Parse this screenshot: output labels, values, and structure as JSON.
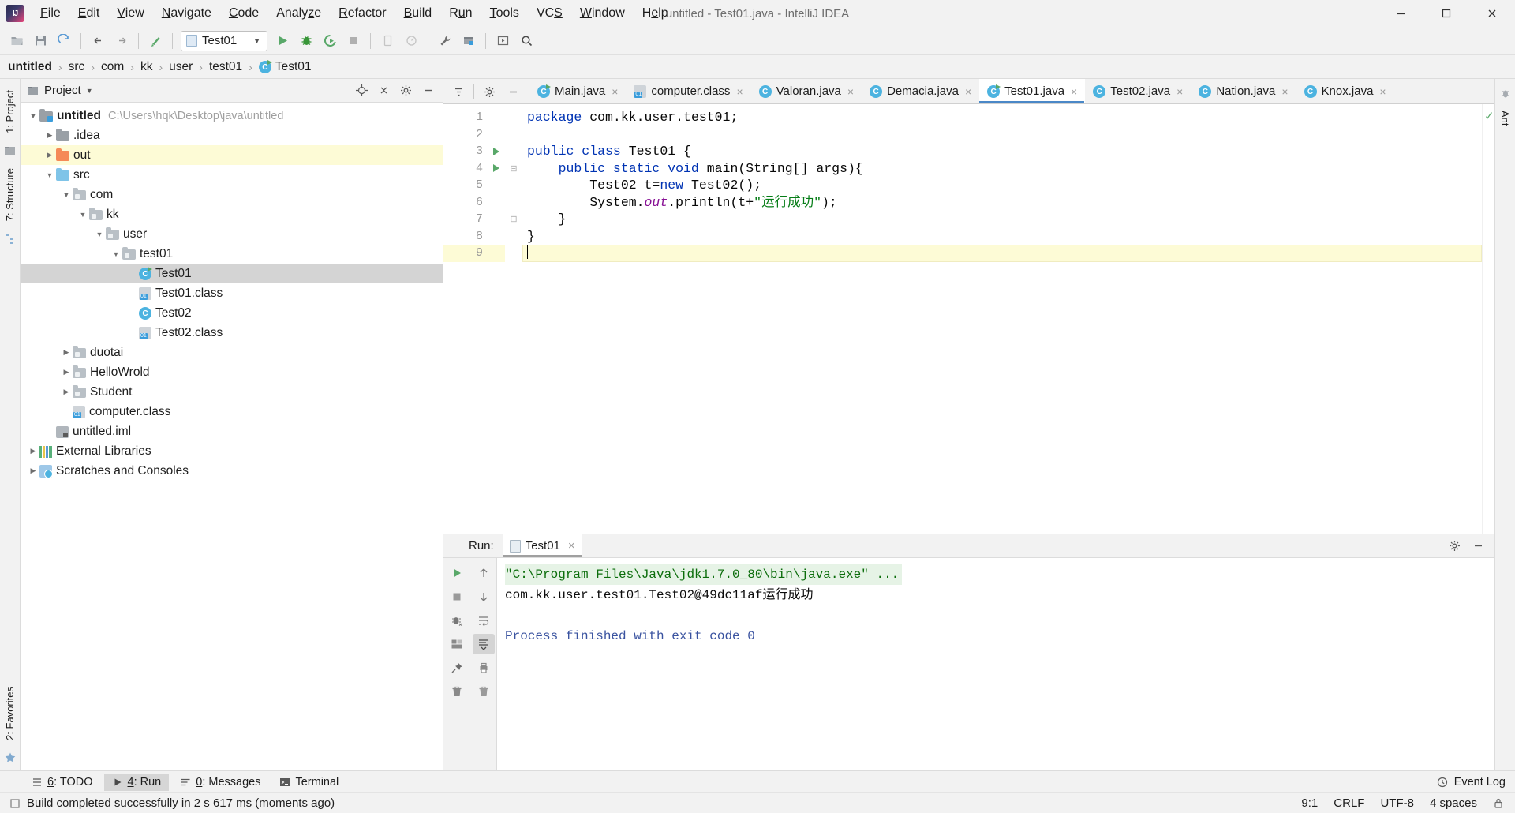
{
  "window": {
    "title": "untitled - Test01.java - IntelliJ IDEA",
    "logo_icon": "intellij-idea-logo-icon",
    "minimize_icon": "minimize-icon",
    "maximize_icon": "maximize-icon",
    "close_icon": "close-icon"
  },
  "menubar": {
    "items": [
      {
        "label": "File",
        "mnemonic": "F"
      },
      {
        "label": "Edit",
        "mnemonic": "E"
      },
      {
        "label": "View",
        "mnemonic": "V"
      },
      {
        "label": "Navigate",
        "mnemonic": "N"
      },
      {
        "label": "Code",
        "mnemonic": "C"
      },
      {
        "label": "Analyze",
        "mnemonic": "z"
      },
      {
        "label": "Refactor",
        "mnemonic": "R"
      },
      {
        "label": "Build",
        "mnemonic": "B"
      },
      {
        "label": "Run",
        "mnemonic": "u"
      },
      {
        "label": "Tools",
        "mnemonic": "T"
      },
      {
        "label": "VCS",
        "mnemonic": "S"
      },
      {
        "label": "Window",
        "mnemonic": "W"
      },
      {
        "label": "Help",
        "mnemonic": "H"
      }
    ]
  },
  "toolbar": {
    "buttons": [
      {
        "name": "open-project-icon",
        "glyph": "folder"
      },
      {
        "name": "save-all-icon",
        "glyph": "save"
      },
      {
        "name": "sync-icon",
        "glyph": "sync"
      },
      {
        "name": "back-icon",
        "glyph": "arrow-left"
      },
      {
        "name": "forward-icon",
        "glyph": "arrow-right"
      },
      {
        "name": "last-edit-location-icon",
        "glyph": "pointer"
      }
    ],
    "run_config": {
      "label": "Test01",
      "icon": "run-configuration-icon",
      "dropdown_icon": "chevron-down-icon"
    },
    "right_buttons": [
      {
        "name": "run-icon",
        "glyph": "play"
      },
      {
        "name": "debug-icon",
        "glyph": "bug"
      },
      {
        "name": "run-with-coverage-icon",
        "glyph": "coverage"
      },
      {
        "name": "stop-icon",
        "glyph": "stop"
      },
      {
        "name": "attach-debugger-icon",
        "glyph": "attach"
      },
      {
        "name": "profiler-icon",
        "glyph": "profiler"
      },
      {
        "name": "settings-wrench-icon",
        "glyph": "wrench"
      },
      {
        "name": "project-structure-icon",
        "glyph": "structure"
      },
      {
        "name": "run-anything-icon",
        "glyph": "runany"
      },
      {
        "name": "search-everywhere-icon",
        "glyph": "search"
      }
    ]
  },
  "breadcrumb": {
    "items": [
      {
        "label": "untitled",
        "bold": true,
        "icon": ""
      },
      {
        "label": "src",
        "bold": false,
        "icon": ""
      },
      {
        "label": "com",
        "bold": false,
        "icon": ""
      },
      {
        "label": "kk",
        "bold": false,
        "icon": ""
      },
      {
        "label": "user",
        "bold": false,
        "icon": ""
      },
      {
        "label": "test01",
        "bold": false,
        "icon": ""
      },
      {
        "label": "Test01",
        "bold": false,
        "icon": "java-class-icon"
      }
    ],
    "separator": "›"
  },
  "left_strip": {
    "tabs": [
      {
        "label": "1: Project",
        "name": "tool-window-project"
      },
      {
        "label": "7: Structure",
        "name": "tool-window-structure"
      },
      {
        "label": "2: Favorites",
        "name": "tool-window-favorites"
      }
    ]
  },
  "right_strip": {
    "tabs": [
      {
        "label": "Ant",
        "name": "tool-window-ant"
      }
    ]
  },
  "project_panel": {
    "title": "Project",
    "dropdown_icon": "chevron-down-icon",
    "actions": [
      {
        "name": "locate-icon",
        "glyph": "target"
      },
      {
        "name": "collapse-all-icon",
        "glyph": "collapse"
      },
      {
        "name": "settings-gear-icon",
        "glyph": "gear"
      },
      {
        "name": "hide-panel-icon",
        "glyph": "minus"
      }
    ],
    "tree": [
      {
        "label": "untitled",
        "sub": "C:\\Users\\hqk\\Desktop\\java\\untitled",
        "indent": 0,
        "arrow": "down",
        "icon": "module-icon",
        "bold": true,
        "state": ""
      },
      {
        "label": ".idea",
        "sub": "",
        "indent": 1,
        "arrow": "right",
        "icon": "folder-icon",
        "bold": false,
        "state": ""
      },
      {
        "label": "out",
        "sub": "",
        "indent": 1,
        "arrow": "right",
        "icon": "folder-orange-icon",
        "bold": false,
        "state": "highlight"
      },
      {
        "label": "src",
        "sub": "",
        "indent": 1,
        "arrow": "down",
        "icon": "folder-blue-icon",
        "bold": false,
        "state": ""
      },
      {
        "label": "com",
        "sub": "",
        "indent": 2,
        "arrow": "down",
        "icon": "package-icon",
        "bold": false,
        "state": ""
      },
      {
        "label": "kk",
        "sub": "",
        "indent": 3,
        "arrow": "down",
        "icon": "package-icon",
        "bold": false,
        "state": ""
      },
      {
        "label": "user",
        "sub": "",
        "indent": 4,
        "arrow": "down",
        "icon": "package-icon",
        "bold": false,
        "state": ""
      },
      {
        "label": "test01",
        "sub": "",
        "indent": 5,
        "arrow": "down",
        "icon": "package-icon",
        "bold": false,
        "state": ""
      },
      {
        "label": "Test01",
        "sub": "",
        "indent": 6,
        "arrow": "none",
        "icon": "java-class-runnable-icon",
        "bold": false,
        "state": "selected"
      },
      {
        "label": "Test01.class",
        "sub": "",
        "indent": 6,
        "arrow": "none",
        "icon": "class-file-icon",
        "bold": false,
        "state": ""
      },
      {
        "label": "Test02",
        "sub": "",
        "indent": 6,
        "arrow": "none",
        "icon": "java-class-icon",
        "bold": false,
        "state": ""
      },
      {
        "label": "Test02.class",
        "sub": "",
        "indent": 6,
        "arrow": "none",
        "icon": "class-file-icon",
        "bold": false,
        "state": ""
      },
      {
        "label": "duotai",
        "sub": "",
        "indent": 2,
        "arrow": "right",
        "icon": "package-icon",
        "bold": false,
        "state": ""
      },
      {
        "label": "HelloWrold",
        "sub": "",
        "indent": 2,
        "arrow": "right",
        "icon": "package-icon",
        "bold": false,
        "state": ""
      },
      {
        "label": "Student",
        "sub": "",
        "indent": 2,
        "arrow": "right",
        "icon": "package-icon",
        "bold": false,
        "state": ""
      },
      {
        "label": "computer.class",
        "sub": "",
        "indent": 2,
        "arrow": "none",
        "icon": "class-file-icon",
        "bold": false,
        "state": ""
      },
      {
        "label": "untitled.iml",
        "sub": "",
        "indent": 1,
        "arrow": "none",
        "icon": "iml-file-icon",
        "bold": false,
        "state": ""
      },
      {
        "label": "External Libraries",
        "sub": "",
        "indent": 0,
        "arrow": "right",
        "icon": "library-icon",
        "bold": false,
        "state": ""
      },
      {
        "label": "Scratches and Consoles",
        "sub": "",
        "indent": 0,
        "arrow": "right",
        "icon": "scratches-icon",
        "bold": false,
        "state": ""
      }
    ]
  },
  "editor": {
    "tab_actions": [
      {
        "name": "select-opened-file-icon",
        "glyph": "selectfile"
      },
      {
        "name": "editor-settings-gear-icon",
        "glyph": "gear"
      },
      {
        "name": "hide-editor-icon",
        "glyph": "minus"
      }
    ],
    "tabs": [
      {
        "label": "Main.java",
        "icon": "java-class-runnable-icon",
        "active": false
      },
      {
        "label": "computer.class",
        "icon": "class-file-icon",
        "active": false
      },
      {
        "label": "Valoran.java",
        "icon": "java-class-icon",
        "active": false
      },
      {
        "label": "Demacia.java",
        "icon": "java-class-icon",
        "active": false
      },
      {
        "label": "Test01.java",
        "icon": "java-class-runnable-icon",
        "active": true
      },
      {
        "label": "Test02.java",
        "icon": "java-class-icon",
        "active": false
      },
      {
        "label": "Nation.java",
        "icon": "java-class-icon",
        "active": false
      },
      {
        "label": "Knox.java",
        "icon": "java-class-icon",
        "active": false
      }
    ],
    "close_glyph": "×",
    "inspection_ok_icon": "checkmark-icon",
    "lines": [
      {
        "num": "1",
        "runmark": false,
        "fold": "",
        "highlight": false,
        "tokens": [
          {
            "t": "package ",
            "c": "kw"
          },
          {
            "t": "com.kk.user.test01;",
            "c": "plain"
          }
        ]
      },
      {
        "num": "2",
        "runmark": false,
        "fold": "",
        "highlight": false,
        "tokens": []
      },
      {
        "num": "3",
        "runmark": true,
        "fold": "",
        "highlight": false,
        "tokens": [
          {
            "t": "public class ",
            "c": "kw"
          },
          {
            "t": "Test01 {",
            "c": "plain"
          }
        ]
      },
      {
        "num": "4",
        "runmark": true,
        "fold": "⊟",
        "highlight": false,
        "tokens": [
          {
            "t": "    ",
            "c": "plain"
          },
          {
            "t": "public static void ",
            "c": "kw"
          },
          {
            "t": "main(String[] args){",
            "c": "plain"
          }
        ]
      },
      {
        "num": "5",
        "runmark": false,
        "fold": "",
        "highlight": false,
        "tokens": [
          {
            "t": "        Test02 t=",
            "c": "plain"
          },
          {
            "t": "new ",
            "c": "kw"
          },
          {
            "t": "Test02();",
            "c": "plain"
          }
        ]
      },
      {
        "num": "6",
        "runmark": false,
        "fold": "",
        "highlight": false,
        "tokens": [
          {
            "t": "        System.",
            "c": "plain"
          },
          {
            "t": "out",
            "c": "fld"
          },
          {
            "t": ".println(t+",
            "c": "plain"
          },
          {
            "t": "\"运行成功\"",
            "c": "str"
          },
          {
            "t": ");",
            "c": "plain"
          }
        ]
      },
      {
        "num": "7",
        "runmark": false,
        "fold": "⊟",
        "highlight": false,
        "tokens": [
          {
            "t": "    }",
            "c": "plain"
          }
        ]
      },
      {
        "num": "8",
        "runmark": false,
        "fold": "",
        "highlight": false,
        "tokens": [
          {
            "t": "}",
            "c": "plain"
          }
        ]
      },
      {
        "num": "9",
        "runmark": false,
        "fold": "",
        "highlight": true,
        "tokens": []
      }
    ]
  },
  "run_panel": {
    "label": "Run:",
    "tab_label": "Test01",
    "tab_icon": "console-icon",
    "tab_close": "×",
    "header_actions": [
      {
        "name": "run-panel-settings-icon",
        "glyph": "gear"
      },
      {
        "name": "hide-run-panel-icon",
        "glyph": "minus"
      }
    ],
    "left_tools": [
      {
        "name": "rerun-button",
        "glyph": "play",
        "selected": false
      },
      {
        "name": "stop-button",
        "glyph": "stop",
        "selected": false
      },
      {
        "name": "debug-tests-button",
        "glyph": "debugicon",
        "selected": false
      },
      {
        "name": "layout-button",
        "glyph": "layout",
        "selected": false
      },
      {
        "name": "pin-button",
        "glyph": "pin",
        "selected": false
      }
    ],
    "mid_tools": [
      {
        "name": "scroll-up-button",
        "glyph": "arrow-up",
        "selected": false
      },
      {
        "name": "scroll-down-button",
        "glyph": "arrow-down",
        "selected": false
      },
      {
        "name": "soft-wrap-button",
        "glyph": "wrap",
        "selected": false
      },
      {
        "name": "scroll-to-end-button",
        "glyph": "scrollend",
        "selected": true
      },
      {
        "name": "print-button",
        "glyph": "print",
        "selected": false
      },
      {
        "name": "clear-all-button",
        "glyph": "trash",
        "selected": false
      }
    ],
    "console": [
      {
        "text": "\"C:\\Program Files\\Java\\jdk1.7.0_80\\bin\\java.exe\" ...",
        "style": "cmd"
      },
      {
        "text": "com.kk.user.test01.Test02@49dc11af运行成功",
        "style": "out"
      },
      {
        "text": "",
        "style": "out"
      },
      {
        "text": "Process finished with exit code 0",
        "style": "fin"
      }
    ]
  },
  "toolwindow_bar": {
    "items": [
      {
        "label": "6: TODO",
        "mnemonic": "6",
        "icon": "todo-icon",
        "active": false
      },
      {
        "label": "4: Run",
        "mnemonic": "4",
        "icon": "run-icon",
        "active": true
      },
      {
        "label": "0: Messages",
        "mnemonic": "0",
        "icon": "messages-icon",
        "active": false
      },
      {
        "label": "Terminal",
        "mnemonic": "",
        "icon": "terminal-icon",
        "active": false
      }
    ],
    "event_log": {
      "label": "Event Log",
      "icon": "event-log-icon"
    }
  },
  "statusbar": {
    "message": "Build completed successfully in 2 s 617 ms (moments ago)",
    "message_icon": "build-status-icon",
    "caret_position": "9:1",
    "line_separator": "CRLF",
    "encoding": "UTF-8",
    "indent": "4 spaces",
    "lock_icon": "lock-icon"
  },
  "colors": {
    "accent_blue": "#4a88c7",
    "keyword_blue": "#0033b3",
    "string_green": "#067d17",
    "field_purple": "#871094",
    "run_green": "#59a869",
    "selection_gray": "#d4d4d4",
    "highlight_yellow": "#fdfbd6",
    "panel_bg": "#f2f2f2"
  }
}
